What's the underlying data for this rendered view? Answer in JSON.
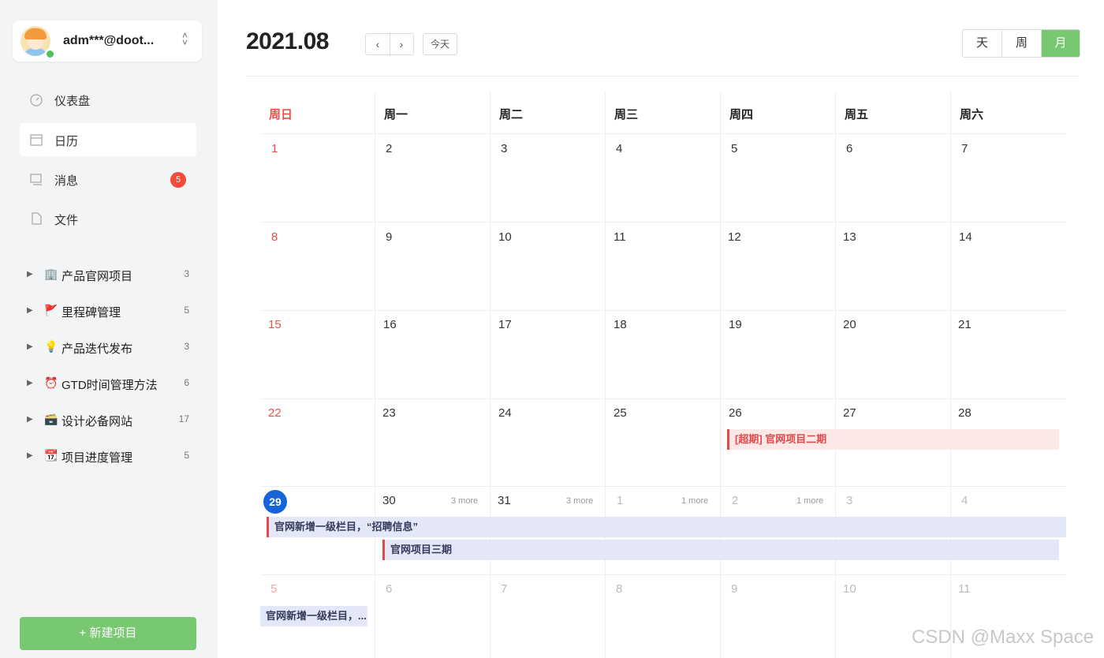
{
  "account": {
    "name": "adm***@doot..."
  },
  "nav": {
    "dashboard": "仪表盘",
    "calendar": "日历",
    "messages": "消息",
    "messages_badge": "5",
    "files": "文件"
  },
  "projects": [
    {
      "icon": "🏢",
      "label": "产品官网项目",
      "count": "3"
    },
    {
      "icon": "🚩",
      "label": "里程碑管理",
      "count": "5"
    },
    {
      "icon": "💡",
      "label": "产品迭代发布",
      "count": "3"
    },
    {
      "icon": "⏰",
      "label": "GTD时间管理方法",
      "count": "6"
    },
    {
      "icon": "🗃️",
      "label": "设计必备网站",
      "count": "17"
    },
    {
      "icon": "📆",
      "label": "项目进度管理",
      "count": "5"
    }
  ],
  "new_project": "+ 新建项目",
  "header": {
    "month": "2021.08",
    "prev": "‹",
    "next": "›",
    "today": "今天",
    "view_day": "天",
    "view_week": "周",
    "view_month": "月"
  },
  "weekdays": [
    "周日",
    "周一",
    "周二",
    "周三",
    "周四",
    "周五",
    "周六"
  ],
  "weeks": [
    [
      "1",
      "2",
      "3",
      "4",
      "5",
      "6",
      "7"
    ],
    [
      "8",
      "9",
      "10",
      "11",
      "12",
      "13",
      "14"
    ],
    [
      "15",
      "16",
      "17",
      "18",
      "19",
      "20",
      "21"
    ],
    [
      "22",
      "23",
      "24",
      "25",
      "26",
      "27",
      "28"
    ],
    [
      "29",
      "30",
      "31",
      "1",
      "2",
      "3",
      "4"
    ],
    [
      "5",
      "6",
      "7",
      "8",
      "9",
      "10",
      "11"
    ]
  ],
  "more_labels": {
    "d30": "3 more",
    "d31": "3 more",
    "sep1": "1 more",
    "sep2": "1 more"
  },
  "events": {
    "overdue": "[超期] 官网项目二期",
    "recruit": "官网新增一级栏目，“招聘信息”",
    "phase3": "官网项目三期",
    "recruit_short": "官网新增一级栏目，..."
  },
  "colors": {
    "accent_green": "#77c871",
    "sunday_red": "#e8504a",
    "today_blue": "#1565d8",
    "badge_red": "#f24b3a"
  },
  "watermark": "CSDN @Maxx Space"
}
